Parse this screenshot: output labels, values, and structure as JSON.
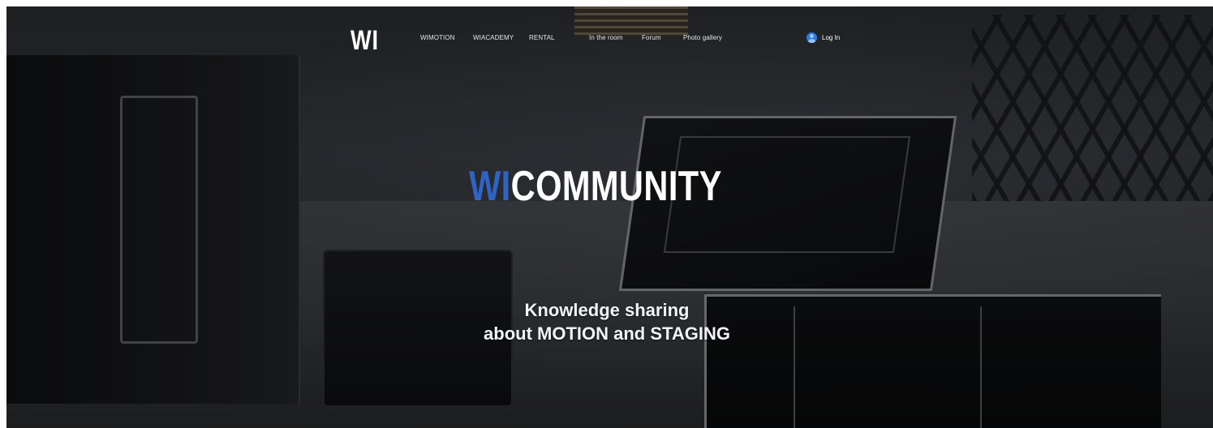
{
  "header": {
    "logo_text": "WI",
    "nav_items": [
      {
        "label": "WIMOTION"
      },
      {
        "label": "WIACADEMY"
      },
      {
        "label": "RENTAL"
      },
      {
        "label": "In the room"
      },
      {
        "label": "Forum"
      },
      {
        "label": "Photo gallery"
      }
    ],
    "login": {
      "label": "Log In",
      "icon": "user-avatar-icon",
      "icon_color": "#2c7be5"
    }
  },
  "hero": {
    "title_accent": "WI",
    "title_rest": "COMMUNITY",
    "accent_color": "#2f63c4",
    "subtitle_line1": "Knowledge sharing",
    "subtitle_line2": "about MOTION and STAGING"
  }
}
